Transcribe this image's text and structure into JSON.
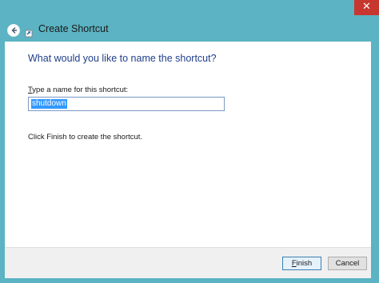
{
  "window": {
    "close_glyph": "✕"
  },
  "header": {
    "title": "Create Shortcut",
    "back_icon": "back-arrow-icon",
    "app_icon": "shortcut-icon"
  },
  "main": {
    "heading": "What would you like to name the shortcut?",
    "field_label_prefix": "T",
    "field_label_rest": "ype a name for this shortcut:",
    "input_value": "shutdown",
    "info_text": "Click Finish to create the shortcut."
  },
  "footer": {
    "finish_prefix": "F",
    "finish_rest": "inish",
    "cancel_label": "Cancel"
  },
  "colors": {
    "frame": "#5bb3c3",
    "heading": "#1f3f8a",
    "selection": "#3399ff",
    "close": "#c7372f"
  }
}
